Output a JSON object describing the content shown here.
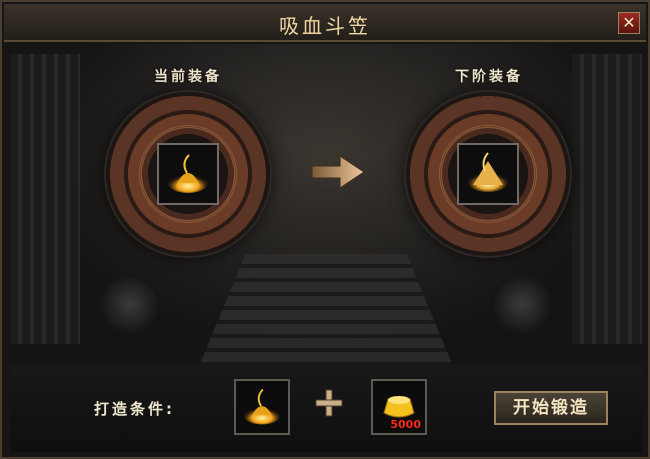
{
  "window": {
    "title": "吸血斗笠",
    "close_symbol": "✕"
  },
  "slots": {
    "current_label": "当前装备",
    "next_label": "下阶装备",
    "current_item_icon": "golden-hat-icon",
    "next_item_icon": "golden-hat-upgraded-icon"
  },
  "arrow_icon": "right-arrow-icon",
  "crafting": {
    "condition_label": "打造条件:",
    "material_1_icon": "golden-hat-icon",
    "plus_icon": "plus-icon",
    "material_2_icon": "gold-ingot-icon",
    "material_2_count": "5000",
    "forge_button_label": "开始锻造"
  },
  "colors": {
    "title_text": "#efd7a1",
    "label_text": "#f1e7cf",
    "count_red": "#ff2a1a",
    "button_border": "#9a8460"
  }
}
